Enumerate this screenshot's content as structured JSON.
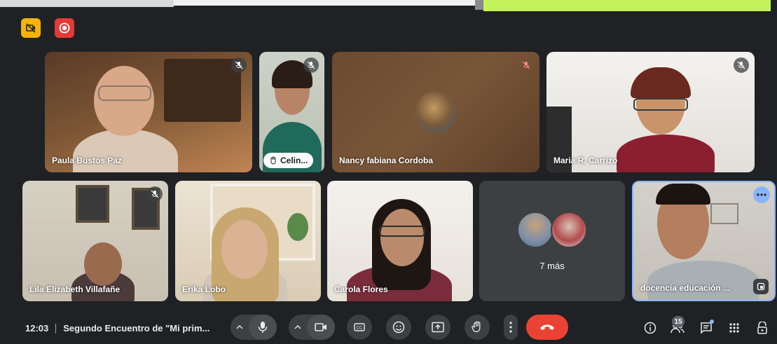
{
  "meeting": {
    "time": "12:03",
    "title": "Segundo Encuentro de \"Mi prim..."
  },
  "participants": [
    {
      "name": "Paula Bustos Paz",
      "muted": true
    },
    {
      "name": "Celin...",
      "muted": true,
      "hand_raised": true
    },
    {
      "name": "Nancy fabiana Cordoba",
      "muted": true,
      "camera_off": true
    },
    {
      "name": "Maria R. Carrizo",
      "muted": true
    },
    {
      "name": "Lila Elizabeth Villafañe",
      "muted": true
    },
    {
      "name": "Erika Lobo",
      "muted": false
    },
    {
      "name": "Carola Flores",
      "muted": false
    },
    {
      "name": "docencia educación ...",
      "muted": false
    }
  ],
  "overflow": {
    "label": "7 más"
  },
  "people_count": "15",
  "colors": {
    "background": "#202124",
    "control": "#3c4043",
    "end_call": "#ea4335",
    "accent": "#8ab4f8",
    "record_badge": "#e53935",
    "warning_badge": "#f6b400"
  },
  "icons": {
    "badges": [
      "no-video-badge-icon",
      "recording-icon"
    ],
    "controls": [
      "chevron-up-icon",
      "mic-icon",
      "chevron-up-icon",
      "camera-icon",
      "captions-icon",
      "emoji-icon",
      "present-icon",
      "raise-hand-icon",
      "more-options-icon",
      "end-call-icon"
    ],
    "right": [
      "info-icon",
      "people-icon",
      "chat-icon",
      "activities-icon",
      "host-controls-icon"
    ]
  }
}
